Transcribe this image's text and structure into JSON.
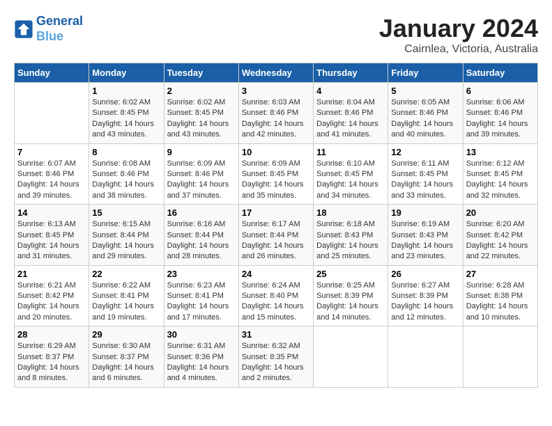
{
  "header": {
    "logo_line1": "General",
    "logo_line2": "Blue",
    "title": "January 2024",
    "subtitle": "Cairnlea, Victoria, Australia"
  },
  "calendar": {
    "days_of_week": [
      "Sunday",
      "Monday",
      "Tuesday",
      "Wednesday",
      "Thursday",
      "Friday",
      "Saturday"
    ],
    "weeks": [
      [
        {
          "day": "",
          "content": ""
        },
        {
          "day": "1",
          "content": "Sunrise: 6:02 AM\nSunset: 8:45 PM\nDaylight: 14 hours\nand 43 minutes."
        },
        {
          "day": "2",
          "content": "Sunrise: 6:02 AM\nSunset: 8:45 PM\nDaylight: 14 hours\nand 43 minutes."
        },
        {
          "day": "3",
          "content": "Sunrise: 6:03 AM\nSunset: 8:46 PM\nDaylight: 14 hours\nand 42 minutes."
        },
        {
          "day": "4",
          "content": "Sunrise: 6:04 AM\nSunset: 8:46 PM\nDaylight: 14 hours\nand 41 minutes."
        },
        {
          "day": "5",
          "content": "Sunrise: 6:05 AM\nSunset: 8:46 PM\nDaylight: 14 hours\nand 40 minutes."
        },
        {
          "day": "6",
          "content": "Sunrise: 6:06 AM\nSunset: 8:46 PM\nDaylight: 14 hours\nand 39 minutes."
        }
      ],
      [
        {
          "day": "7",
          "content": "Sunrise: 6:07 AM\nSunset: 8:46 PM\nDaylight: 14 hours\nand 39 minutes."
        },
        {
          "day": "8",
          "content": "Sunrise: 6:08 AM\nSunset: 8:46 PM\nDaylight: 14 hours\nand 38 minutes."
        },
        {
          "day": "9",
          "content": "Sunrise: 6:09 AM\nSunset: 8:46 PM\nDaylight: 14 hours\nand 37 minutes."
        },
        {
          "day": "10",
          "content": "Sunrise: 6:09 AM\nSunset: 8:45 PM\nDaylight: 14 hours\nand 35 minutes."
        },
        {
          "day": "11",
          "content": "Sunrise: 6:10 AM\nSunset: 8:45 PM\nDaylight: 14 hours\nand 34 minutes."
        },
        {
          "day": "12",
          "content": "Sunrise: 6:11 AM\nSunset: 8:45 PM\nDaylight: 14 hours\nand 33 minutes."
        },
        {
          "day": "13",
          "content": "Sunrise: 6:12 AM\nSunset: 8:45 PM\nDaylight: 14 hours\nand 32 minutes."
        }
      ],
      [
        {
          "day": "14",
          "content": "Sunrise: 6:13 AM\nSunset: 8:45 PM\nDaylight: 14 hours\nand 31 minutes."
        },
        {
          "day": "15",
          "content": "Sunrise: 6:15 AM\nSunset: 8:44 PM\nDaylight: 14 hours\nand 29 minutes."
        },
        {
          "day": "16",
          "content": "Sunrise: 6:16 AM\nSunset: 8:44 PM\nDaylight: 14 hours\nand 28 minutes."
        },
        {
          "day": "17",
          "content": "Sunrise: 6:17 AM\nSunset: 8:44 PM\nDaylight: 14 hours\nand 26 minutes."
        },
        {
          "day": "18",
          "content": "Sunrise: 6:18 AM\nSunset: 8:43 PM\nDaylight: 14 hours\nand 25 minutes."
        },
        {
          "day": "19",
          "content": "Sunrise: 6:19 AM\nSunset: 8:43 PM\nDaylight: 14 hours\nand 23 minutes."
        },
        {
          "day": "20",
          "content": "Sunrise: 6:20 AM\nSunset: 8:42 PM\nDaylight: 14 hours\nand 22 minutes."
        }
      ],
      [
        {
          "day": "21",
          "content": "Sunrise: 6:21 AM\nSunset: 8:42 PM\nDaylight: 14 hours\nand 20 minutes."
        },
        {
          "day": "22",
          "content": "Sunrise: 6:22 AM\nSunset: 8:41 PM\nDaylight: 14 hours\nand 19 minutes."
        },
        {
          "day": "23",
          "content": "Sunrise: 6:23 AM\nSunset: 8:41 PM\nDaylight: 14 hours\nand 17 minutes."
        },
        {
          "day": "24",
          "content": "Sunrise: 6:24 AM\nSunset: 8:40 PM\nDaylight: 14 hours\nand 15 minutes."
        },
        {
          "day": "25",
          "content": "Sunrise: 6:25 AM\nSunset: 8:39 PM\nDaylight: 14 hours\nand 14 minutes."
        },
        {
          "day": "26",
          "content": "Sunrise: 6:27 AM\nSunset: 8:39 PM\nDaylight: 14 hours\nand 12 minutes."
        },
        {
          "day": "27",
          "content": "Sunrise: 6:28 AM\nSunset: 8:38 PM\nDaylight: 14 hours\nand 10 minutes."
        }
      ],
      [
        {
          "day": "28",
          "content": "Sunrise: 6:29 AM\nSunset: 8:37 PM\nDaylight: 14 hours\nand 8 minutes."
        },
        {
          "day": "29",
          "content": "Sunrise: 6:30 AM\nSunset: 8:37 PM\nDaylight: 14 hours\nand 6 minutes."
        },
        {
          "day": "30",
          "content": "Sunrise: 6:31 AM\nSunset: 8:36 PM\nDaylight: 14 hours\nand 4 minutes."
        },
        {
          "day": "31",
          "content": "Sunrise: 6:32 AM\nSunset: 8:35 PM\nDaylight: 14 hours\nand 2 minutes."
        },
        {
          "day": "",
          "content": ""
        },
        {
          "day": "",
          "content": ""
        },
        {
          "day": "",
          "content": ""
        }
      ]
    ]
  }
}
